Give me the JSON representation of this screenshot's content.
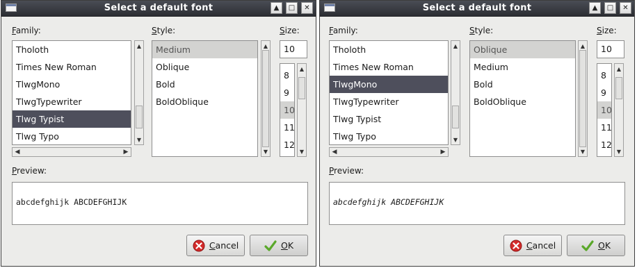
{
  "dialogs": [
    {
      "title": "Select a default font",
      "labels": {
        "family": "Family:",
        "style": "Style:",
        "size": "Size:",
        "preview": "Preview:"
      },
      "family_items": [
        {
          "label": "Tholoth",
          "state": ""
        },
        {
          "label": "Times New Roman",
          "state": ""
        },
        {
          "label": "TlwgMono",
          "state": ""
        },
        {
          "label": "TlwgTypewriter",
          "state": ""
        },
        {
          "label": "Tlwg Typist",
          "state": "sel"
        },
        {
          "label": "Tlwg Typo",
          "state": ""
        }
      ],
      "style_items": [
        {
          "label": "Medium",
          "state": "hl"
        },
        {
          "label": "Oblique",
          "state": ""
        },
        {
          "label": "Bold",
          "state": ""
        },
        {
          "label": "BoldOblique",
          "state": ""
        }
      ],
      "size_value": "10",
      "size_items": [
        {
          "label": "8",
          "state": ""
        },
        {
          "label": "9",
          "state": ""
        },
        {
          "label": "10",
          "state": "hl"
        },
        {
          "label": "11",
          "state": ""
        },
        {
          "label": "12",
          "state": ""
        }
      ],
      "preview_text": "abcdefghijk ABCDEFGHIJK",
      "preview_italic": false,
      "buttons": {
        "cancel": "Cancel",
        "ok": "OK"
      }
    },
    {
      "title": "Select a default font",
      "labels": {
        "family": "Family:",
        "style": "Style:",
        "size": "Size:",
        "preview": "Preview:"
      },
      "family_items": [
        {
          "label": "Tholoth",
          "state": ""
        },
        {
          "label": "Times New Roman",
          "state": ""
        },
        {
          "label": "TlwgMono",
          "state": "sel"
        },
        {
          "label": "TlwgTypewriter",
          "state": ""
        },
        {
          "label": "Tlwg Typist",
          "state": ""
        },
        {
          "label": "Tlwg Typo",
          "state": ""
        }
      ],
      "style_items": [
        {
          "label": "Oblique",
          "state": "hl"
        },
        {
          "label": "Medium",
          "state": ""
        },
        {
          "label": "Bold",
          "state": ""
        },
        {
          "label": "BoldOblique",
          "state": ""
        }
      ],
      "size_value": "10",
      "size_items": [
        {
          "label": "8",
          "state": ""
        },
        {
          "label": "9",
          "state": ""
        },
        {
          "label": "10",
          "state": "hl"
        },
        {
          "label": "11",
          "state": ""
        },
        {
          "label": "12",
          "state": ""
        }
      ],
      "preview_text": "abcdefghijk ABCDEFGHIJK",
      "preview_italic": true,
      "buttons": {
        "cancel": "Cancel",
        "ok": "OK"
      }
    }
  ],
  "icons": {
    "titlebar": [
      "window-menu-icon",
      "roll-up-icon",
      "maximize-icon",
      "close-icon"
    ],
    "cancel": "cancel-icon",
    "ok": "ok-checkmark-icon"
  },
  "colors": {
    "titlebar": "#2c2e33",
    "selection": "#4e4f5c",
    "highlight": "#d3d3d1",
    "cancel_icon": "#d42a2a",
    "ok_icon": "#5aa82a"
  }
}
